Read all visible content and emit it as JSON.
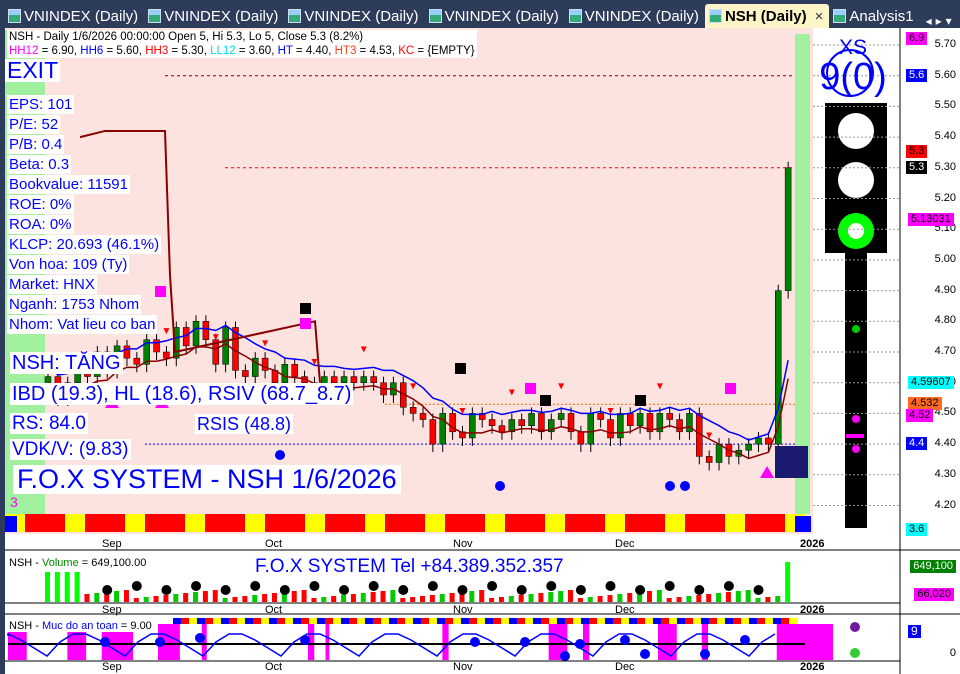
{
  "tabs": [
    {
      "label": "VNINDEX (Daily)"
    },
    {
      "label": "VNINDEX (Daily)"
    },
    {
      "label": "VNINDEX (Daily)"
    },
    {
      "label": "VNINDEX (Daily)"
    },
    {
      "label": "VNINDEX (Daily)"
    },
    {
      "label": "NSH (Daily)",
      "active": true
    },
    {
      "label": "Analysis1"
    }
  ],
  "close_glyph": "×",
  "header": {
    "line1": "NSH - Daily 1/6/2026 00:00:00 Open 5, Hi 5.3, Lo 5, Close 5.3 (8.2%)",
    "line2": [
      {
        "t": "HH12",
        "c": "#ff00ff"
      },
      {
        "t": " = 6.90, ",
        "c": "#000"
      },
      {
        "t": "HH6",
        "c": "#0000ff"
      },
      {
        "t": " = 5.60, ",
        "c": "#000"
      },
      {
        "t": "HH3",
        "c": "#ff0000"
      },
      {
        "t": " = 5.30, ",
        "c": "#000"
      },
      {
        "t": "LL12",
        "c": "#00e0e0"
      },
      {
        "t": " = 3.60, ",
        "c": "#000"
      },
      {
        "t": "HT",
        "c": "#0000ff"
      },
      {
        "t": "  = 4.40, ",
        "c": "#000"
      },
      {
        "t": "HT3",
        "c": "#ff4020"
      },
      {
        "t": "  = 4.53, ",
        "c": "#000"
      },
      {
        "t": "KC",
        "c": "#ff0000"
      },
      {
        "t": " = {EMPTY}",
        "c": "#000"
      }
    ]
  },
  "signal": "EXIT",
  "fundamentals": [
    "EPS: 101",
    "P/E: 52",
    "P/B: 0.4",
    "Beta: 0.3",
    "Bookvalue: 11591",
    "ROE: 0%",
    "ROA: 0%",
    "KLCP: 20.693 (46.1%)",
    "Von hoa: 109 (Ty)",
    "Market: HNX",
    "Nganh: 1753 Nhom",
    "Nhom: Vat lieu co ban"
  ],
  "trend": "NSH: TĂNG",
  "ibd": "IBD (19.3), HL (18.6), RSIV (68.7_8.7)",
  "rs": "RS: 84.0",
  "rsis": "RSIS (48.8)",
  "vdk": "VDK/V:  (9.83)",
  "watermark": "F.O.X SYSTEM - NSH 1/6/2026",
  "pane_num": "3",
  "rating": {
    "label": "XS",
    "value": "9(0)"
  },
  "traffic_light": {
    "active": "green"
  },
  "price_axis": [
    "5.70",
    "5.60",
    "5.50",
    "5.40",
    "5.30",
    "5.20",
    "5.10",
    "5.00",
    "4.90",
    "4.80",
    "4.70",
    "4.60",
    "4.50",
    "4.40",
    "4.30",
    "4.20"
  ],
  "price_tags": [
    {
      "t": "6.9",
      "bg": "#ff00ff",
      "fg": "#000",
      "p": 5.72
    },
    {
      "t": "5.6",
      "bg": "#0000ff",
      "fg": "#fff",
      "p": 5.6
    },
    {
      "t": "5.3",
      "bg": "#ff0000",
      "fg": "#000",
      "p": 5.35
    },
    {
      "t": "5.3",
      "bg": "#000",
      "fg": "#fff",
      "p": 5.3
    },
    {
      "t": "5.13031",
      "bg": "#ff00ff",
      "fg": "#000",
      "p": 5.13
    },
    {
      "t": "4.59607",
      "bg": "#00ffff",
      "fg": "#000",
      "p": 4.6
    },
    {
      "t": "4.532",
      "bg": "#ff6a20",
      "fg": "#000",
      "p": 4.53
    },
    {
      "t": "4.52",
      "bg": "#ff00ff",
      "fg": "#000",
      "p": 4.49
    },
    {
      "t": "4.4",
      "bg": "#0000ff",
      "fg": "#fff",
      "p": 4.4
    },
    {
      "t": "3.6",
      "bg": "#00ffff",
      "fg": "#000",
      "p": 4.12
    }
  ],
  "dates": [
    "Sep",
    "Oct",
    "Nov",
    "Dec",
    "2026"
  ],
  "volume": {
    "title_sym": "NSH",
    "title_name": "Volume",
    "title_val": " = 649,100.00",
    "banner": "F.O.X SYSTEM Tel +84.389.352.357",
    "tag1": "649,100",
    "tag2": "66,020"
  },
  "safety": {
    "title_sym": "NSH",
    "title_name": "Muc do an toan",
    "title_val": " = 9.00",
    "tag": "9",
    "zero": "0"
  },
  "colors": {
    "bull": "#008000",
    "bear": "#ff0000",
    "bg": "#fde3e0",
    "green_band": "#a0f0a0"
  },
  "closes": [
    4.62,
    4.55,
    4.6,
    4.66,
    4.62,
    4.7,
    4.64,
    4.72,
    4.68,
    4.66,
    4.74,
    4.7,
    4.68,
    4.78,
    4.72,
    4.8,
    4.74,
    4.66,
    4.78,
    4.64,
    4.62,
    4.68,
    4.64,
    4.6,
    4.66,
    4.62,
    4.6,
    4.58,
    4.62,
    4.6,
    4.62,
    4.6,
    4.62,
    4.6,
    4.56,
    4.6,
    4.52,
    4.5,
    4.48,
    4.4,
    4.5,
    4.44,
    4.42,
    4.5,
    4.48,
    4.46,
    4.44,
    4.48,
    4.46,
    4.5,
    4.44,
    4.48,
    4.5,
    4.44,
    4.4,
    4.5,
    4.48,
    4.42,
    4.5,
    4.46,
    4.5,
    4.44,
    4.5,
    4.48,
    4.44,
    4.5,
    4.36,
    4.34,
    4.4,
    4.36,
    4.38,
    4.4,
    4.42,
    4.4,
    4.9,
    5.3
  ]
}
